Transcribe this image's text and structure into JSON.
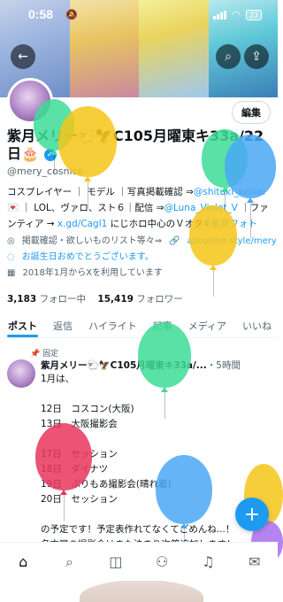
{
  "status_bar": {
    "time": "0:58",
    "battery": "23"
  },
  "profile": {
    "edit_label": "編集",
    "display_name": "紫月メリー🐑🦅C105月曜東キ33a/22日🎂",
    "handle": "@mery_cosnico",
    "bio_line1": "コスプレイヤー ｜ モデル ｜写真掲載確認 ⇒",
    "bio_link1": "@shitukI_keikai",
    "bio_line2": "💌 ｜ LOL、ヴァロ、スト６｜配信 ⇒",
    "bio_link2": "@Luna_Violet_V",
    "bio_line2b": " ｜ファンティア → ",
    "bio_link3": "x.gd/Cagl1",
    "bio_line3": " にじホロ中心のＶオタ",
    "bio_link4": "#紫月フォト",
    "meta_category": "掲載確認・欲しいものリスト等々⇒",
    "meta_url": "aboutme.style/mery",
    "meta_birthday": "お誕生日おめでとうございます。",
    "meta_joined": "2018年1月からXを利用しています",
    "following_count": "3,183",
    "following_label": "フォロー中",
    "followers_count": "15,419",
    "followers_label": "フォロワー"
  },
  "tabs": [
    "ポスト",
    "返信",
    "ハイライト",
    "記事",
    "メディア",
    "いいね"
  ],
  "pinned_post": {
    "pinned_label": "固定",
    "author": "紫月メリー🐑🦅C105月曜東キ33a/...",
    "time": "・5時間",
    "body": "1月は、\n\n12日　コスコン(大阪)\n13日　大阪撮影会\n\n17日　セッション\n18日　ダイナツ\n19日　ぷりもあ撮影会(晴れ着)\n20日　セッション\n\nの予定です！予定表作れてなくてごめんね...！\n名古屋の撮影会はまた決まり次第追加します！"
  },
  "nav": [
    "home-icon",
    "search-icon",
    "grok-icon",
    "communities-icon",
    "notifications-icon",
    "messages-icon"
  ],
  "colors": {
    "accent": "#1d9bf0",
    "text": "#0f1419",
    "secondary": "#536471"
  },
  "balloons": [
    {
      "color": "#3ddc97"
    },
    {
      "color": "#f5c518"
    },
    {
      "color": "#3ddc97"
    },
    {
      "color": "#4aa8f5"
    },
    {
      "color": "#f5c518"
    },
    {
      "color": "#3ddc97"
    },
    {
      "color": "#e8365d"
    },
    {
      "color": "#4aa8f5"
    },
    {
      "color": "#f5c518"
    },
    {
      "color": "#a96ef0"
    }
  ]
}
